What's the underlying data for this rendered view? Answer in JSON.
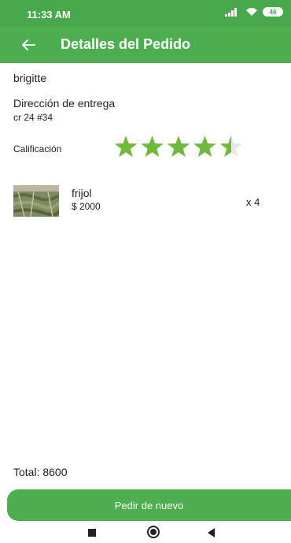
{
  "status_bar": {
    "time": "11:33 AM",
    "battery": "46"
  },
  "app_bar": {
    "title": "Detalles del Pedido"
  },
  "order": {
    "customer": "brigitte",
    "address_label": "Dirección de entrega",
    "address": "cr 24 #34",
    "rating_label": "Calificación",
    "rating": 4.5,
    "rating_max": 5
  },
  "items": [
    {
      "name": "frijol",
      "price": "$ 2000",
      "quantity": "x 4"
    }
  ],
  "total": "Total: 8600",
  "actions": {
    "reorder_label": "Pedir de nuevo"
  },
  "colors": {
    "primary": "#4cae4f",
    "status_bar": "#47a94b",
    "star_filled": "#6fba3a",
    "star_empty": "#e6e6e6"
  },
  "icons": {
    "back": "arrow-left-icon",
    "signal": "signal-icon",
    "wifi": "wifi-icon",
    "battery": "battery-icon",
    "nav_recent": "square-icon",
    "nav_home": "circle-icon",
    "nav_back": "triangle-back-icon"
  }
}
